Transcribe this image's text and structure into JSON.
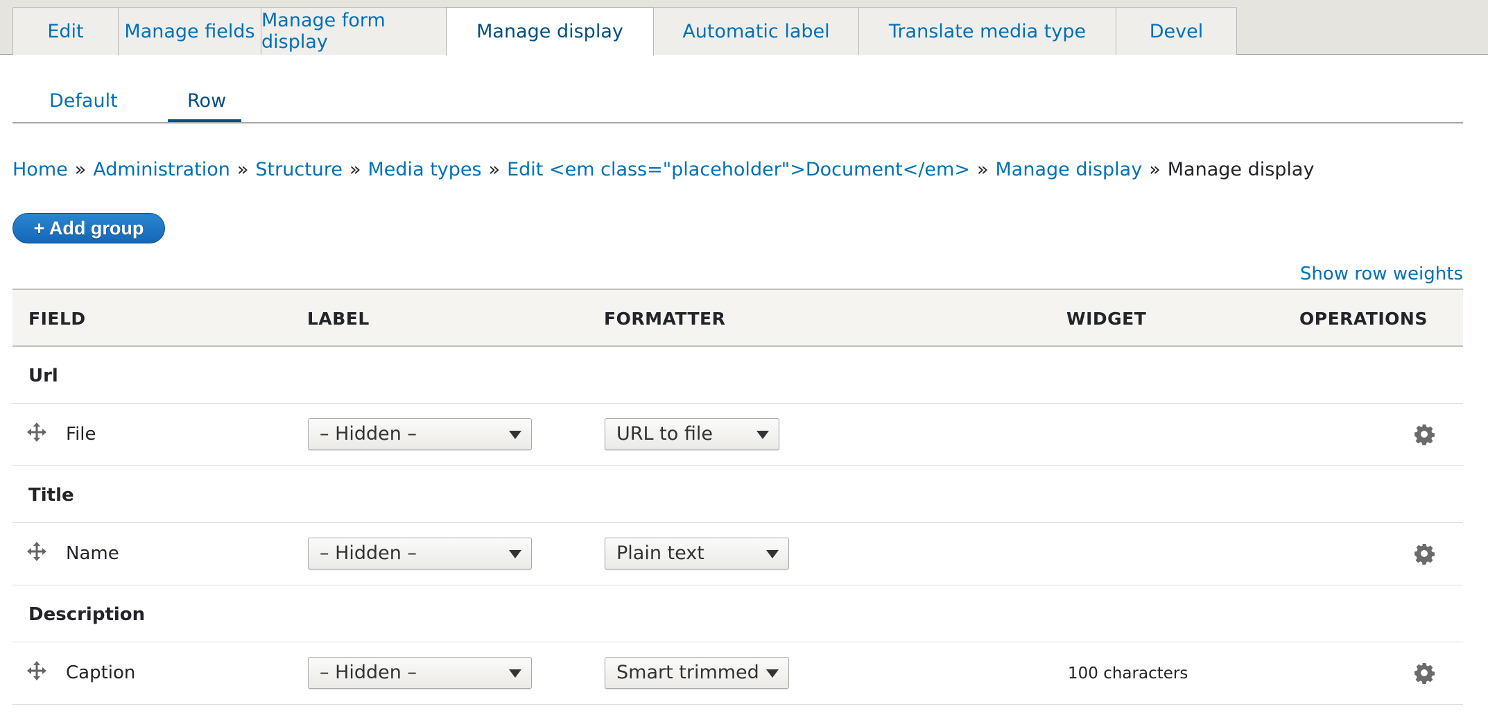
{
  "primary_tabs": [
    {
      "label": "Edit",
      "active": false
    },
    {
      "label": "Manage fields",
      "active": false
    },
    {
      "label": "Manage form display",
      "active": false
    },
    {
      "label": "Manage display",
      "active": true
    },
    {
      "label": "Automatic label",
      "active": false
    },
    {
      "label": "Translate media type",
      "active": false
    },
    {
      "label": "Devel",
      "active": false
    }
  ],
  "secondary_tabs": [
    {
      "label": "Default",
      "active": false
    },
    {
      "label": "Row",
      "active": true
    }
  ],
  "breadcrumb": {
    "items": [
      "Home",
      "Administration",
      "Structure",
      "Media types",
      "Edit <em class=\"placeholder\">Document</em>",
      "Manage display"
    ],
    "current": "Manage display",
    "separator": "»"
  },
  "add_group_button": "+ Add group",
  "show_row_weights": "Show row weights",
  "table": {
    "headers": {
      "field": "FIELD",
      "label": "LABEL",
      "formatter": "FORMATTER",
      "widget": "WIDGET",
      "operations": "OPERATIONS"
    },
    "regions": [
      {
        "title": "Url",
        "field": {
          "name": "File",
          "label_select": "– Hidden –",
          "formatter_select": "URL to file",
          "widget": ""
        }
      },
      {
        "title": "Title",
        "field": {
          "name": "Name",
          "label_select": "– Hidden –",
          "formatter_select": "Plain text",
          "widget": ""
        }
      },
      {
        "title": "Description",
        "field": {
          "name": "Caption",
          "label_select": "– Hidden –",
          "formatter_select": "Smart trimmed",
          "widget": "100 characters"
        }
      }
    ]
  },
  "colors": {
    "link": "#0071b8",
    "active_tab": "#004f80",
    "button": "#1567b8",
    "tab_bar_bg": "#e6e4df"
  },
  "icons": {
    "drag": "move-arrows-icon",
    "operations": "gear-icon",
    "select": "chevron-down-icon"
  }
}
